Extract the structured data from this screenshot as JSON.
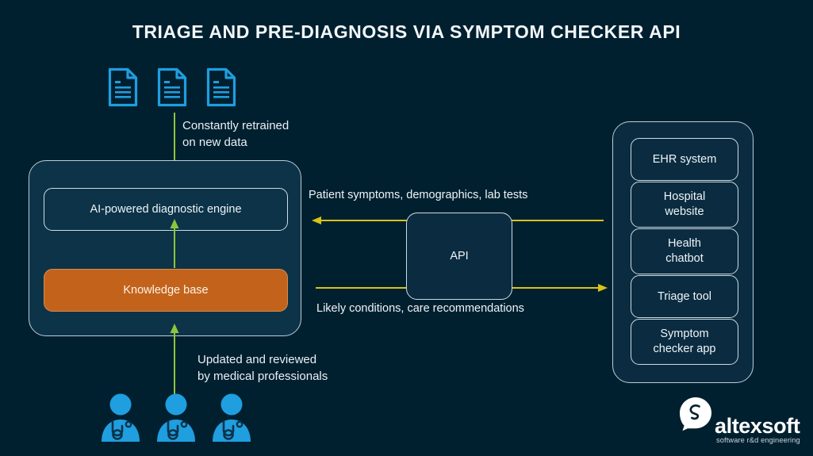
{
  "page": {
    "title": "TRIAGE AND PRE-DIAGNOSIS VIA SYMPTOM CHECKER API",
    "background_color": "#01202f"
  },
  "colors": {
    "accent_blue": "#1f9ee0",
    "panel_navy": "#0c3348",
    "orange": "#c3631b",
    "green_arrow": "#8cc63e",
    "yellow_arrow": "#d8c317",
    "text": "#eef4f8",
    "border": "#b9cdd9"
  },
  "sources": {
    "icons": [
      {
        "name": "document-icon-1"
      },
      {
        "name": "document-icon-2"
      },
      {
        "name": "document-icon-3"
      }
    ],
    "caption_line1": "Constantly retrained",
    "caption_line2": "on new data"
  },
  "left_panel": {
    "engine": {
      "label": "AI-powered diagnostic engine"
    },
    "knowledge_base": {
      "label": "Knowledge base"
    }
  },
  "reviewers": {
    "icons": [
      {
        "name": "doctor-icon-1"
      },
      {
        "name": "doctor-icon-2"
      },
      {
        "name": "doctor-icon-3"
      }
    ],
    "caption_line1": "Updated and reviewed",
    "caption_line2": "by medical professionals"
  },
  "flows": {
    "inbound_label": "Patient symptoms, demographics, lab tests",
    "outbound_label": "Likely conditions, care recommendations"
  },
  "api": {
    "label": "API"
  },
  "systems": {
    "items": [
      {
        "label": "EHR system",
        "lines": [
          "EHR system"
        ]
      },
      {
        "label": "Hospital website",
        "lines": [
          "Hospital",
          "website"
        ]
      },
      {
        "label": "Health chatbot",
        "lines": [
          "Health",
          "chatbot"
        ]
      },
      {
        "label": "Triage tool",
        "lines": [
          "Triage tool"
        ]
      },
      {
        "label": "Symptom checker app",
        "lines": [
          "Symptom",
          "checker app"
        ]
      }
    ]
  },
  "logo": {
    "name": "altexsoft",
    "tagline": "software r&d engineering"
  }
}
